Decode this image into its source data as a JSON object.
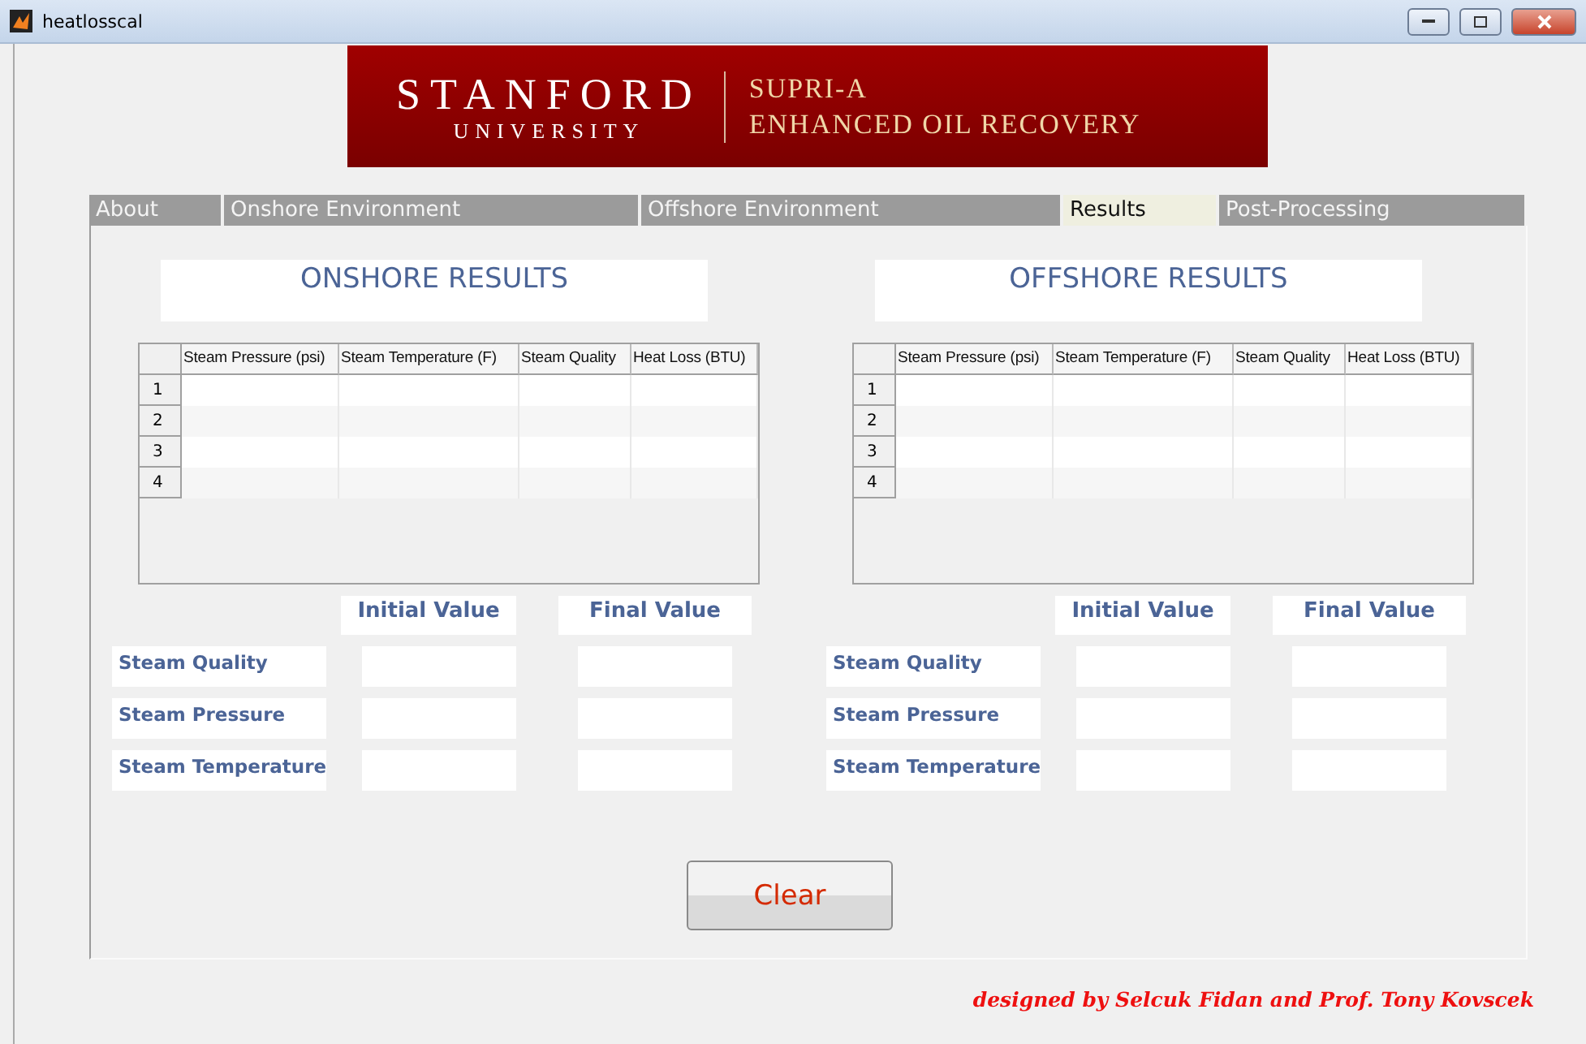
{
  "window": {
    "title": "heatlosscal"
  },
  "banner": {
    "university": "STANFORD",
    "subtitle": "UNIVERSITY",
    "program": "SUPRI-A",
    "department": "ENHANCED OIL RECOVERY"
  },
  "tabs": [
    {
      "label": "About",
      "selected": false
    },
    {
      "label": "Onshore Environment",
      "selected": false
    },
    {
      "label": "Offshore Environment",
      "selected": false
    },
    {
      "label": "Results",
      "selected": true
    },
    {
      "label": "Post-Processing",
      "selected": false
    }
  ],
  "sections": [
    {
      "title": "ONSHORE RESULTS",
      "table": {
        "columns": [
          "Steam Pressure (psi)",
          "Steam Temperature (F)",
          "Steam Quality",
          "Heat Loss (BTU)"
        ],
        "rows": [
          "1",
          "2",
          "3",
          "4"
        ]
      },
      "value_headers": [
        "Initial Value",
        "Final Value"
      ],
      "value_rows": [
        "Steam Quality",
        "Steam Pressure",
        "Steam Temperature"
      ]
    },
    {
      "title": "OFFSHORE RESULTS",
      "table": {
        "columns": [
          "Steam Pressure (psi)",
          "Steam Temperature (F)",
          "Steam Quality",
          "Heat Loss (BTU)"
        ],
        "rows": [
          "1",
          "2",
          "3",
          "4"
        ]
      },
      "value_headers": [
        "Initial Value",
        "Final Value"
      ],
      "value_rows": [
        "Steam Quality",
        "Steam Pressure",
        "Steam Temperature"
      ]
    }
  ],
  "clear_button": "Clear",
  "credit": "designed by Selcuk Fidan and Prof. Tony Kovscek"
}
